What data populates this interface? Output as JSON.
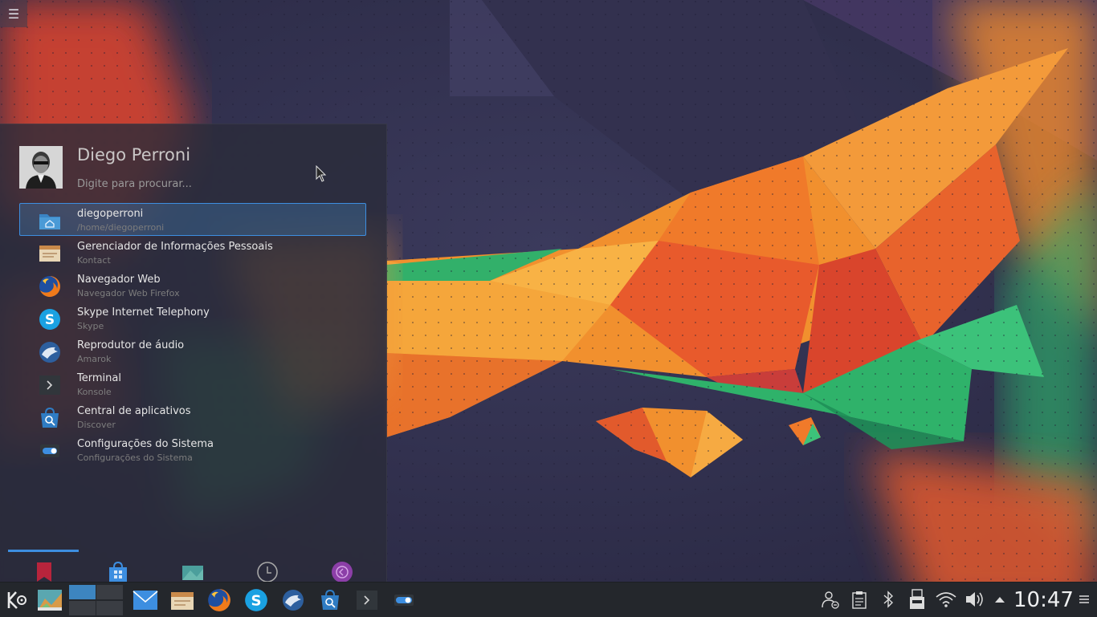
{
  "launcher": {
    "user_name": "Diego Perroni",
    "search_placeholder": "Digite para procurar...",
    "results": [
      {
        "title": "diegoperroni",
        "subtitle": "/home/diegoperroni",
        "icon": "home-folder-icon",
        "selected": true
      },
      {
        "title": "Gerenciador de Informações Pessoais",
        "subtitle": "Kontact",
        "icon": "kontact-icon",
        "selected": false
      },
      {
        "title": "Navegador Web",
        "subtitle": "Navegador Web Firefox",
        "icon": "firefox-icon",
        "selected": false
      },
      {
        "title": "Skype Internet Telephony",
        "subtitle": "Skype",
        "icon": "skype-icon",
        "selected": false
      },
      {
        "title": "Reprodutor de áudio",
        "subtitle": "Amarok",
        "icon": "amarok-icon",
        "selected": false
      },
      {
        "title": "Terminal",
        "subtitle": "Konsole",
        "icon": "terminal-icon",
        "selected": false
      },
      {
        "title": "Central de aplicativos",
        "subtitle": "Discover",
        "icon": "discover-icon",
        "selected": false
      },
      {
        "title": "Configurações do Sistema",
        "subtitle": "Configurações do Sistema",
        "icon": "system-settings-icon",
        "selected": false
      }
    ],
    "tabs": [
      {
        "icon": "favorites-bookmark-icon",
        "active": true
      },
      {
        "icon": "applications-bag-icon",
        "active": false
      },
      {
        "icon": "computer-icon",
        "active": false
      },
      {
        "icon": "history-clock-icon",
        "active": false
      },
      {
        "icon": "leave-icon",
        "active": false
      }
    ]
  },
  "taskbar": {
    "launchers": [
      "kde-menu-icon",
      "show-desktop-icon",
      "mail-icon",
      "kontact-icon",
      "firefox-icon",
      "skype-icon",
      "amarok-icon",
      "discover-icon",
      "terminal-icon",
      "system-settings-icon"
    ],
    "tray": [
      "user-switch-icon",
      "clipboard-icon",
      "bluetooth-icon",
      "usb-device-icon",
      "wifi-icon",
      "volume-icon",
      "expand-tray-icon"
    ],
    "clock": "10:47"
  },
  "colors": {
    "accent": "#3d8ee0",
    "panel": "#24272c",
    "launcher_bg": "#2a2c3a"
  }
}
